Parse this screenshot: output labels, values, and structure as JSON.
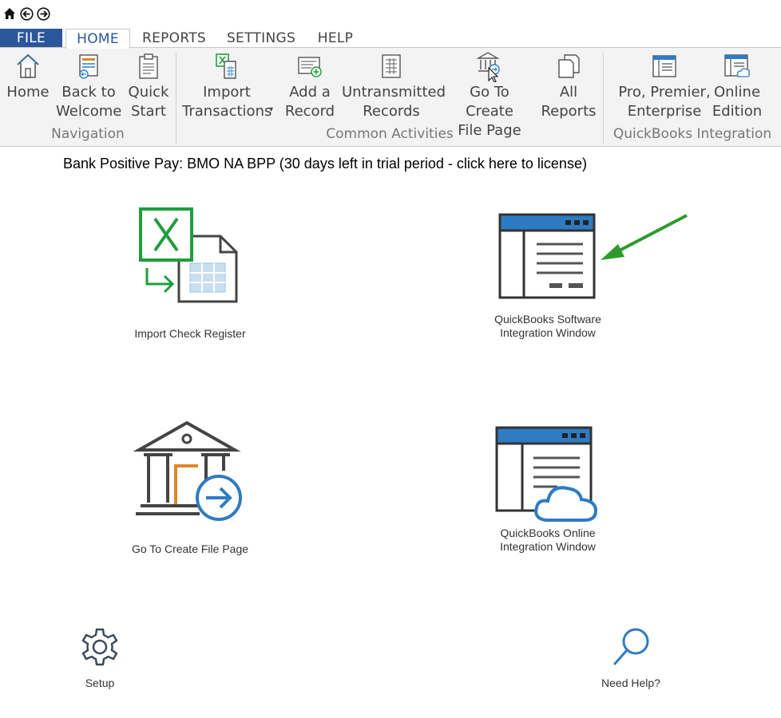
{
  "quick_access": {
    "icons": [
      "home-icon",
      "back-icon",
      "forward-icon"
    ]
  },
  "tabs": [
    {
      "label": "FILE"
    },
    {
      "label": "HOME"
    },
    {
      "label": "REPORTS"
    },
    {
      "label": "SETTINGS"
    },
    {
      "label": "HELP"
    }
  ],
  "ribbon": {
    "groups": {
      "navigation": "Navigation",
      "common": "Common Activities",
      "qb": "QuickBooks Integration"
    },
    "buttons": {
      "home": "Home",
      "back_to_welcome": "Back to\nWelcome",
      "quick_start": "Quick\nStart",
      "import_transactions": "Import\nTransactions",
      "import_dropdown": "▾",
      "add_record": "Add a\nRecord",
      "untransmitted": "Untransmitted\nRecords",
      "go_to_create": "Go To Create\nFile Page",
      "all_reports": "All\nReports",
      "pro_premier": "Pro, Premier,\nEnterprise",
      "online_edition": "Online\nEdition"
    }
  },
  "banner": "Bank Positive Pay: BMO NA BPP (30 days left in trial period - click here to license)",
  "tiles": {
    "import_check": "Import Check Register",
    "qb_software": "QuickBooks Software\nIntegration Window",
    "go_to_create": "Go To Create File Page",
    "qb_online": "QuickBooks Online\nIntegration Window",
    "setup": "Setup",
    "need_help": "Need Help?"
  },
  "colors": {
    "file_tab": "#2b579a",
    "excel_green": "#1f9e3e",
    "accent_blue": "#2e7bc4",
    "arrow_green": "#2e9a2e",
    "orange": "#e0862a"
  }
}
